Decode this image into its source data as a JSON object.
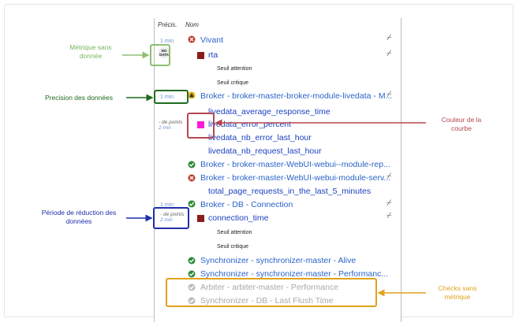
{
  "header": {
    "col_precision": "Précis.",
    "col_name": "Nom"
  },
  "rows": {
    "vivant": "Vivant",
    "rta": "rta",
    "seuil_attention_1": "Seuil attention",
    "seuil_critique_1": "Seuil critique",
    "broker_livedata": "Broker - broker-master-broker-module-livedata - M...",
    "livedata_avg": "livedata_average_response_time",
    "livedata_err_pct": "livedata_error_percent",
    "livedata_err_last": "livedata_nb_error_last_hour",
    "livedata_req_last": "livedata_nb_request_last_hour",
    "broker_webui_rep": "Broker - broker-master-WebUI-webui--module-rep...",
    "broker_webui_serv": "Broker - broker-master-WebUI-webui-module-serv...",
    "total_requests": "total_page_requests_in_the_last_5_minutes",
    "broker_db": "Broker - DB - Connection",
    "connection_time": "connection_time",
    "seuil_attention_2": "Seuil attention",
    "seuil_critique_2": "Seuil critique",
    "sync_alive": "Synchronizer - synchronizer-master - Alive",
    "sync_perf": "Synchronizer - synchronizer-master - Performanc...",
    "arbiter_perf": "Arbiter - arbiter-master - Performance",
    "sync_db": "Synchronizer - DB - Last Flush Time"
  },
  "precision": {
    "vivant": "1 min",
    "broker_livedata": "1 min",
    "livedata_group_label": "- de points",
    "livedata_group_value": "2 min",
    "broker_db": "1 min",
    "connection_group_label": "- de points",
    "connection_group_value": "2 min"
  },
  "badges": {
    "no_data_line1": "NO",
    "no_data_line2": "DATA"
  },
  "annotations": {
    "metric_no_data": "Métrique sans donnée",
    "data_precision": "Precision des données",
    "curve_color": "Couleur de la courbe",
    "reduction_period": "Période de réduction des données",
    "checks_no_metric": "Checks sans métrique"
  },
  "colors": {
    "green": "#7ab55c",
    "dark_green": "#1f6b1f",
    "red": "#b5474f",
    "blue": "#1f2fa8",
    "orange": "#e0a21c",
    "pink": "#ff1ad9"
  }
}
